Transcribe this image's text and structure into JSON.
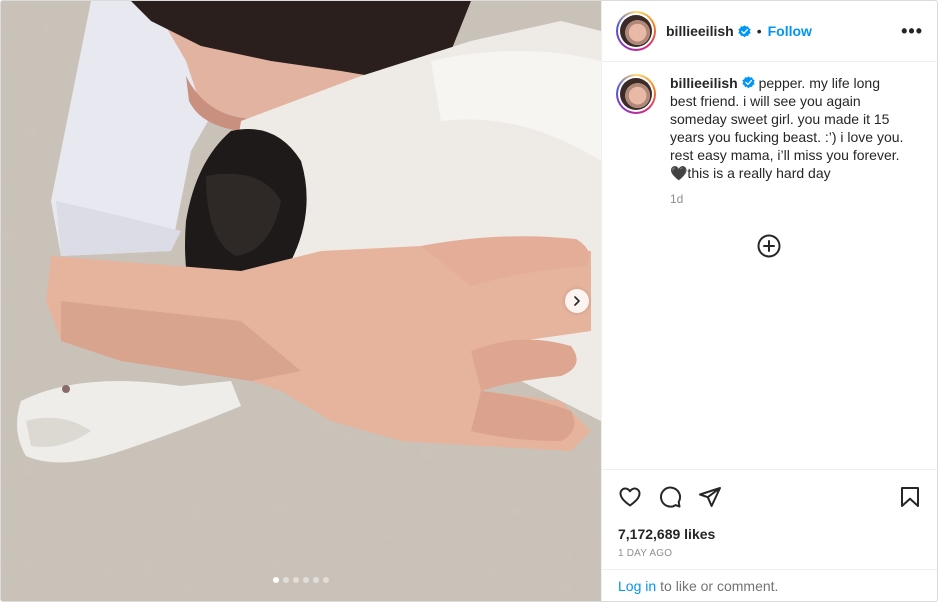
{
  "post": {
    "username": "billieeilish",
    "follow_label": "Follow",
    "separator": "•",
    "more_label": "•••",
    "caption": "pepper. my life long best friend. i will see you again someday sweet girl. you made it 15 years you fucking beast. :’) i love you. rest easy mama, i’ll miss you forever.🖤this is a really hard day",
    "relative_time": "1d",
    "likes": "7,172,689 likes",
    "date": "1 DAY AGO",
    "login_link": "Log in",
    "login_rest": "to like or comment."
  },
  "carousel": {
    "slide_count": 6,
    "active_index": 0
  },
  "icons": {
    "like": "heart-icon",
    "comment": "comment-icon",
    "share": "share-icon",
    "save": "bookmark-icon",
    "verified": "verified-badge-icon",
    "add": "plus-circle-icon",
    "next": "chevron-right-icon"
  },
  "colors": {
    "link": "#0095f6",
    "verified": "#0095f6",
    "text": "#262626",
    "muted": "#8e8e8e"
  }
}
